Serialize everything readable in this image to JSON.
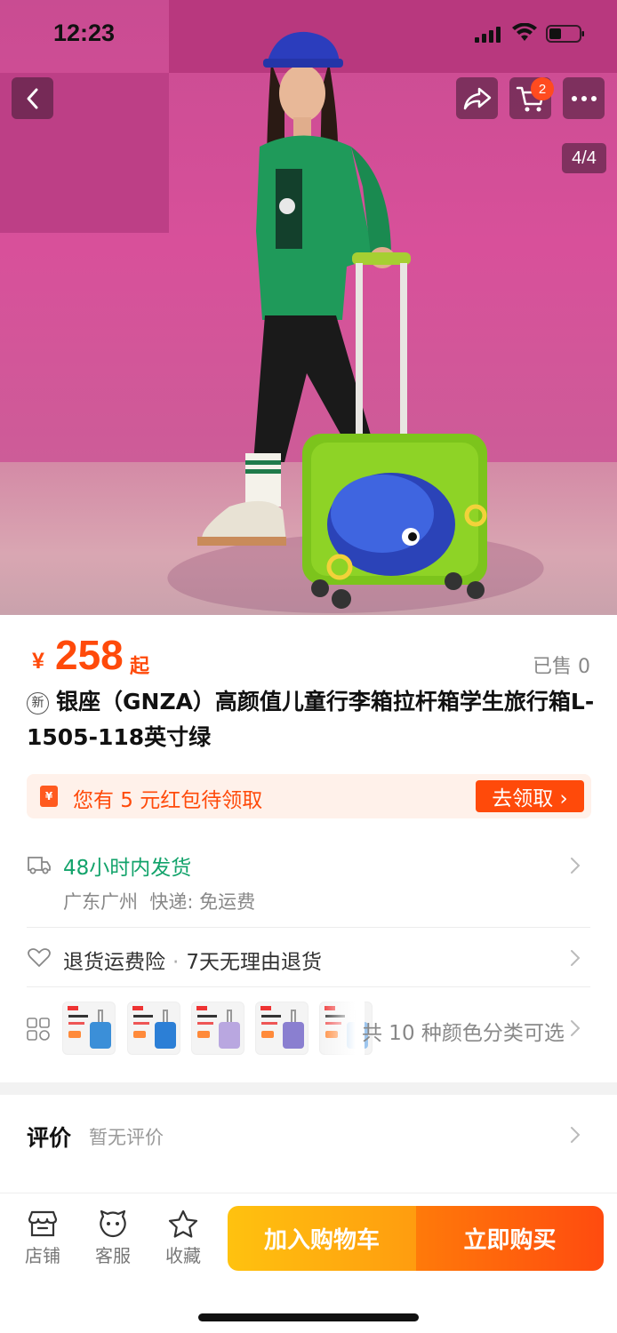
{
  "status_bar": {
    "time": "12:23"
  },
  "hero": {
    "page_indicator": "4/4",
    "cart_count": "2"
  },
  "product": {
    "currency": "¥",
    "price": "258",
    "price_suffix": "起",
    "sold": "已售 0",
    "new_tag": "新",
    "title": "银座（GNZA）高颜值儿童行李箱拉杆箱学生旅行箱L-1505-118英寸绿"
  },
  "coupon": {
    "icon_text": "¥",
    "text": "您有 5 元红包待领取",
    "button": "去领取 ›"
  },
  "shipping": {
    "main": "48小时内发货",
    "origin": "广东广州",
    "express": "快递: 免运费"
  },
  "services": {
    "item1": "退货运费险",
    "separator": "·",
    "item2": "7天无理由退货"
  },
  "sku": {
    "summary": "共 10 种颜色分类可选",
    "thumb_colors": [
      "#3b8fd8",
      "#2c7fd6",
      "#b9a7e0",
      "#8a7fd0",
      "#9ec6ee"
    ]
  },
  "reviews": {
    "label": "评价",
    "empty": "暂无评价"
  },
  "bottom_bar": {
    "store": "店铺",
    "service": "客服",
    "favorite": "收藏",
    "add_to_cart": "加入购物车",
    "buy_now": "立即购买"
  },
  "colors": {
    "accent": "#ff4a0a",
    "green": "#13a36b",
    "cart_cta": "#ffb20f"
  }
}
